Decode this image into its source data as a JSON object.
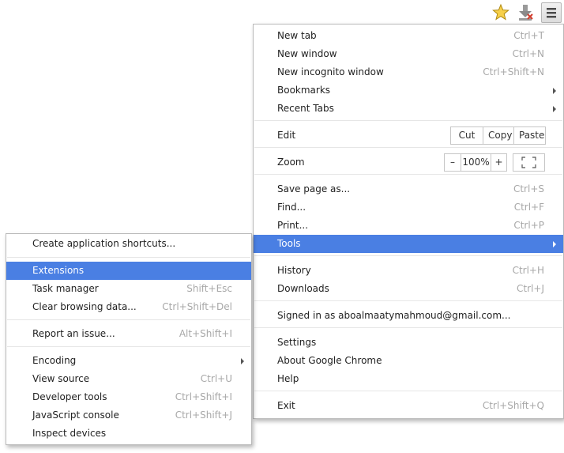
{
  "toolbar": {
    "star_icon": "star-icon",
    "download_icon": "download-icon",
    "menu_icon": "menu-icon"
  },
  "main_menu": {
    "new_tab": {
      "label": "New tab",
      "shortcut": "Ctrl+T"
    },
    "new_window": {
      "label": "New window",
      "shortcut": "Ctrl+N"
    },
    "new_incognito": {
      "label": "New incognito window",
      "shortcut": "Ctrl+Shift+N"
    },
    "bookmarks": {
      "label": "Bookmarks"
    },
    "recent_tabs": {
      "label": "Recent Tabs"
    },
    "edit": {
      "label": "Edit",
      "cut": "Cut",
      "copy": "Copy",
      "paste": "Paste"
    },
    "zoom": {
      "label": "Zoom",
      "minus": "–",
      "value": "100%",
      "plus": "+"
    },
    "save_page": {
      "label": "Save page as...",
      "shortcut": "Ctrl+S"
    },
    "find": {
      "label": "Find...",
      "shortcut": "Ctrl+F"
    },
    "print": {
      "label": "Print...",
      "shortcut": "Ctrl+P"
    },
    "tools": {
      "label": "Tools"
    },
    "history": {
      "label": "History",
      "shortcut": "Ctrl+H"
    },
    "downloads": {
      "label": "Downloads",
      "shortcut": "Ctrl+J"
    },
    "signed_in": {
      "label": "Signed in as aboalmaatymahmoud@gmail.com..."
    },
    "settings": {
      "label": "Settings"
    },
    "about": {
      "label": "About Google Chrome"
    },
    "help": {
      "label": "Help"
    },
    "exit": {
      "label": "Exit",
      "shortcut": "Ctrl+Shift+Q"
    }
  },
  "tools_menu": {
    "create_shortcuts": {
      "label": "Create application shortcuts..."
    },
    "extensions": {
      "label": "Extensions"
    },
    "task_manager": {
      "label": "Task manager",
      "shortcut": "Shift+Esc"
    },
    "clear_data": {
      "label": "Clear browsing data...",
      "shortcut": "Ctrl+Shift+Del"
    },
    "report_issue": {
      "label": "Report an issue...",
      "shortcut": "Alt+Shift+I"
    },
    "encoding": {
      "label": "Encoding"
    },
    "view_source": {
      "label": "View source",
      "shortcut": "Ctrl+U"
    },
    "developer_tools": {
      "label": "Developer tools",
      "shortcut": "Ctrl+Shift+I"
    },
    "js_console": {
      "label": "JavaScript console",
      "shortcut": "Ctrl+Shift+J"
    },
    "inspect_devices": {
      "label": "Inspect devices"
    }
  },
  "colors": {
    "highlight": "#4a7fe3",
    "shortcut_text": "#a8a8a8",
    "star": "#f2c230"
  }
}
